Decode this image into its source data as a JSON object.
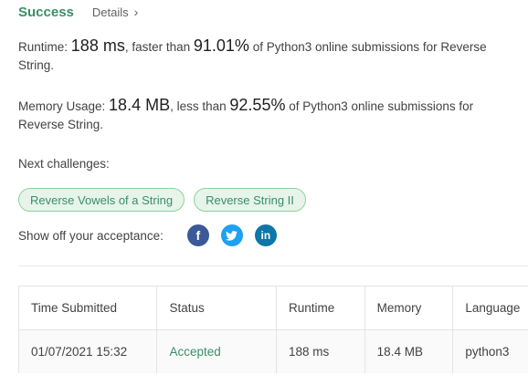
{
  "header": {
    "status": "Success",
    "details_label": "Details",
    "details_chevron": "›"
  },
  "runtime": {
    "label": "Runtime:",
    "value": "188 ms",
    "comparison": ", faster than",
    "percent": "91.01%",
    "suffix": "of Python3 online submissions for Reverse String."
  },
  "memory": {
    "label": "Memory Usage:",
    "value": "18.4 MB",
    "comparison": ", less than",
    "percent": "92.55%",
    "suffix": "of Python3 online submissions for Reverse String."
  },
  "next_challenges": {
    "label": "Next challenges:",
    "items": [
      "Reverse Vowels of a String",
      "Reverse String II"
    ]
  },
  "share": {
    "label": "Show off your acceptance:",
    "icons": [
      {
        "name": "facebook-icon",
        "glyph": "f"
      },
      {
        "name": "twitter-icon",
        "glyph": "t"
      },
      {
        "name": "linkedin-icon",
        "glyph": "in"
      }
    ]
  },
  "submissions": {
    "columns": [
      "Time Submitted",
      "Status",
      "Runtime",
      "Memory",
      "Language"
    ],
    "rows": [
      [
        "01/07/2021 15:32",
        "Accepted",
        "188 ms",
        "18.4 MB",
        "python3"
      ]
    ]
  },
  "colors": {
    "success": "#3a8f66",
    "chip_bg": "#e6f4ea",
    "chip_border": "#8fd19e",
    "facebook": "#3b5998",
    "twitter": "#1da1f2",
    "linkedin": "#0e76a8"
  }
}
